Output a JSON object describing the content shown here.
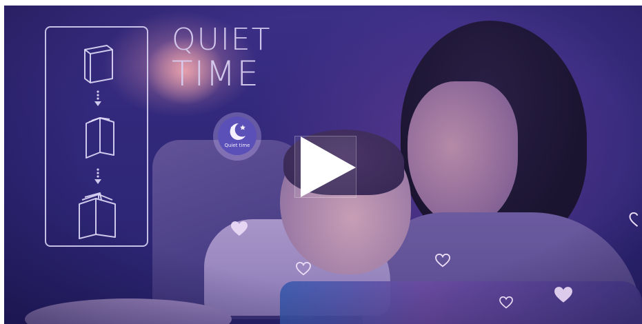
{
  "video": {
    "title_line1": "QUIET",
    "title_line2": "TIME",
    "badge_text": "Quiet time",
    "play_icon": "play-icon"
  },
  "sequence_icons": [
    "closed-book-icon",
    "half-open-book-icon",
    "open-book-icon"
  ],
  "colors": {
    "background": "#31287a",
    "title": "#d7cdf0",
    "panel_border": "#e1dcfa",
    "badge": "#5b4fb8",
    "heart": "#e6d8f5"
  }
}
